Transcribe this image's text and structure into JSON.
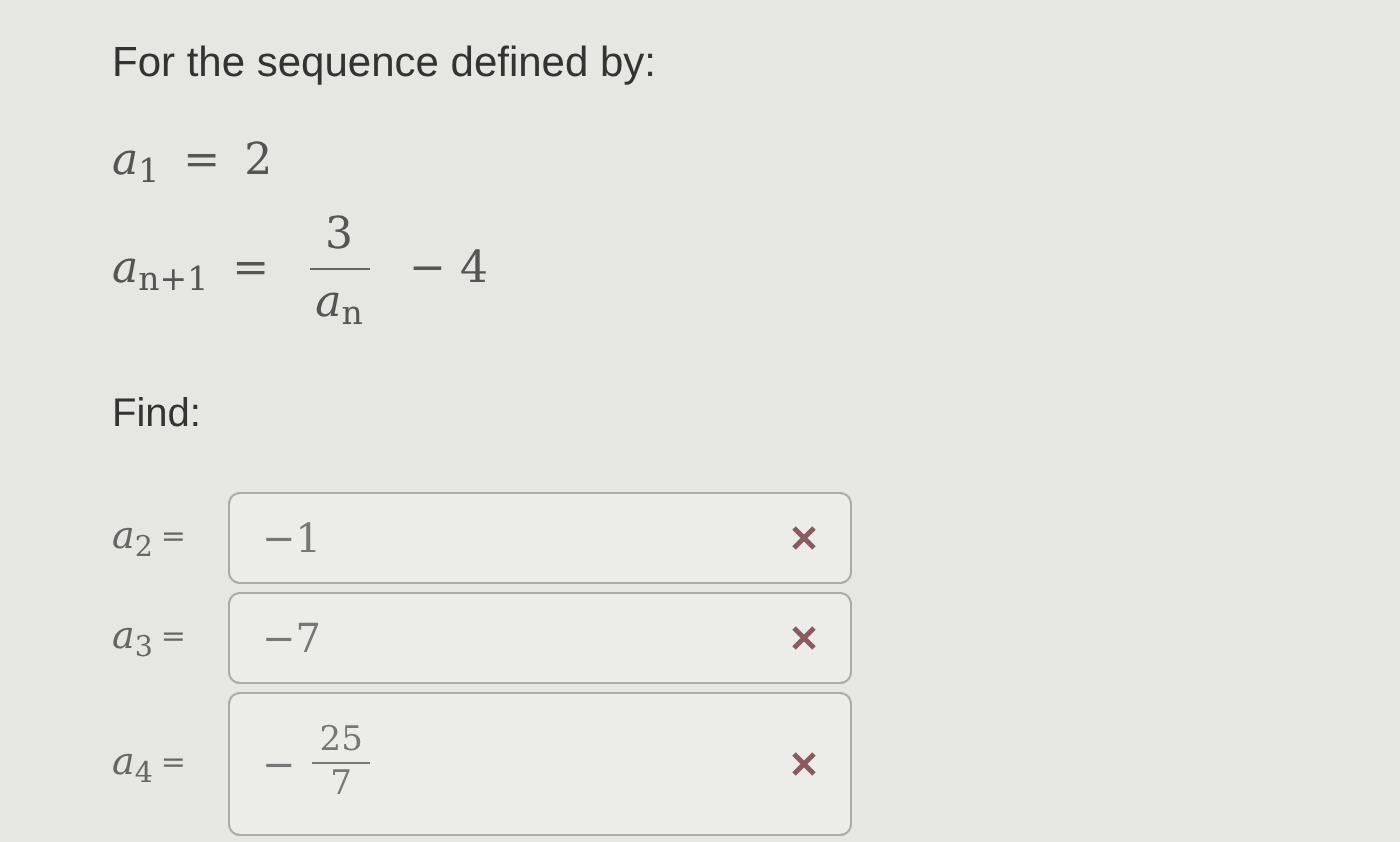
{
  "prompt": "For the sequence defined by:",
  "definition": [
    {
      "kind": "plain",
      "lhs": "*a*$_{1}$",
      "relation": "=",
      "rhs": "2"
    },
    {
      "kind": "fraction",
      "lhs": "*a*$_{n+1}$",
      "relation": "=",
      "numerator": "3",
      "denominator": "*a*$_{n}$",
      "tail": "− 4"
    }
  ],
  "find_label": "Find:",
  "answers": [
    {
      "label": "*a*$_{2}$",
      "relation": "=",
      "kind": "plain",
      "value": "−1",
      "correct": false
    },
    {
      "label": "*a*$_{3}$",
      "relation": "=",
      "kind": "plain",
      "value": "−7",
      "correct": false
    },
    {
      "label": "*a*$_{4}$",
      "relation": "=",
      "kind": "fraction",
      "sign": "−",
      "numerator": "25",
      "denominator": "7",
      "correct": false
    }
  ]
}
